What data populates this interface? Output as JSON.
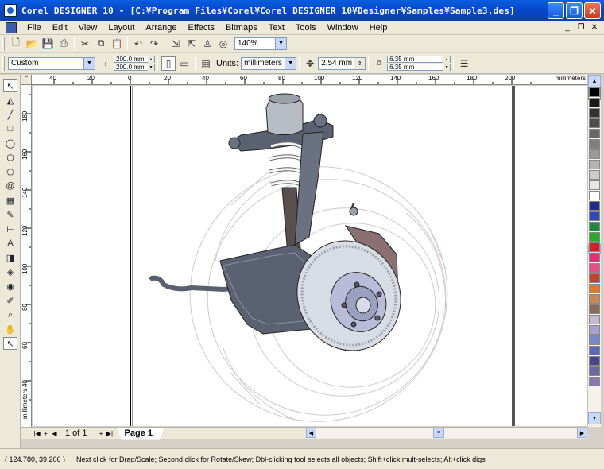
{
  "window": {
    "title": "Corel DESIGNER 10 - [C:¥Program Files¥Corel¥Corel DESIGNER 10¥Designer¥Samples¥Sample3.des]",
    "minimize": "_",
    "restore": "❐",
    "close": "✕"
  },
  "menu": [
    "File",
    "Edit",
    "View",
    "Layout",
    "Arrange",
    "Effects",
    "Bitmaps",
    "Text",
    "Tools",
    "Window",
    "Help"
  ],
  "mdi": {
    "minimize": "_",
    "restore": "❐",
    "close": "✕"
  },
  "standard_toolbar": {
    "zoom": "140%"
  },
  "property_bar": {
    "preset": "Custom",
    "width": "200.0 mm",
    "height": "200.0 mm",
    "units_label": "Units:",
    "units": "millimeters",
    "nudge": "2.54 mm",
    "dup_x": "6.35 mm",
    "dup_y": "6.35 mm"
  },
  "rulers": {
    "h_ticks": [
      "40",
      "20",
      "0",
      "20",
      "40",
      "60",
      "80",
      "100",
      "120",
      "140",
      "160",
      "180",
      "200"
    ],
    "v_ticks": [
      "180",
      "160",
      "140",
      "120",
      "100",
      "80",
      "60",
      "40"
    ],
    "units": "millimeters",
    "corner": "⌐"
  },
  "palette": {
    "none": "✕",
    "colors": [
      "#000000",
      "#1a1a1a",
      "#333333",
      "#4d4d4d",
      "#666666",
      "#808080",
      "#999999",
      "#b3b3b3",
      "#cccccc",
      "#e6e6e6",
      "#ffffff",
      "#1f2c8a",
      "#2c4bb8",
      "#1e8a3c",
      "#2ea82e",
      "#d82020",
      "#e0307a",
      "#e8508a",
      "#c8402c",
      "#e07830",
      "#c88858",
      "#8a6a5a",
      "#c8b8d8",
      "#a8a0d0",
      "#7888c8",
      "#5a6ab8",
      "#484888",
      "#6a6aa0",
      "#8878b0"
    ]
  },
  "document": {
    "page_count": "1 of 1",
    "page_tab": "Page 1"
  },
  "status": {
    "coords": "( 124.780, 39.206 )",
    "hint": "Next click for Drag/Scale; Second click for Rotate/Skew; Dbl-clicking tool selects all objects; Shift+click mult-selects; Alt+click digs"
  }
}
